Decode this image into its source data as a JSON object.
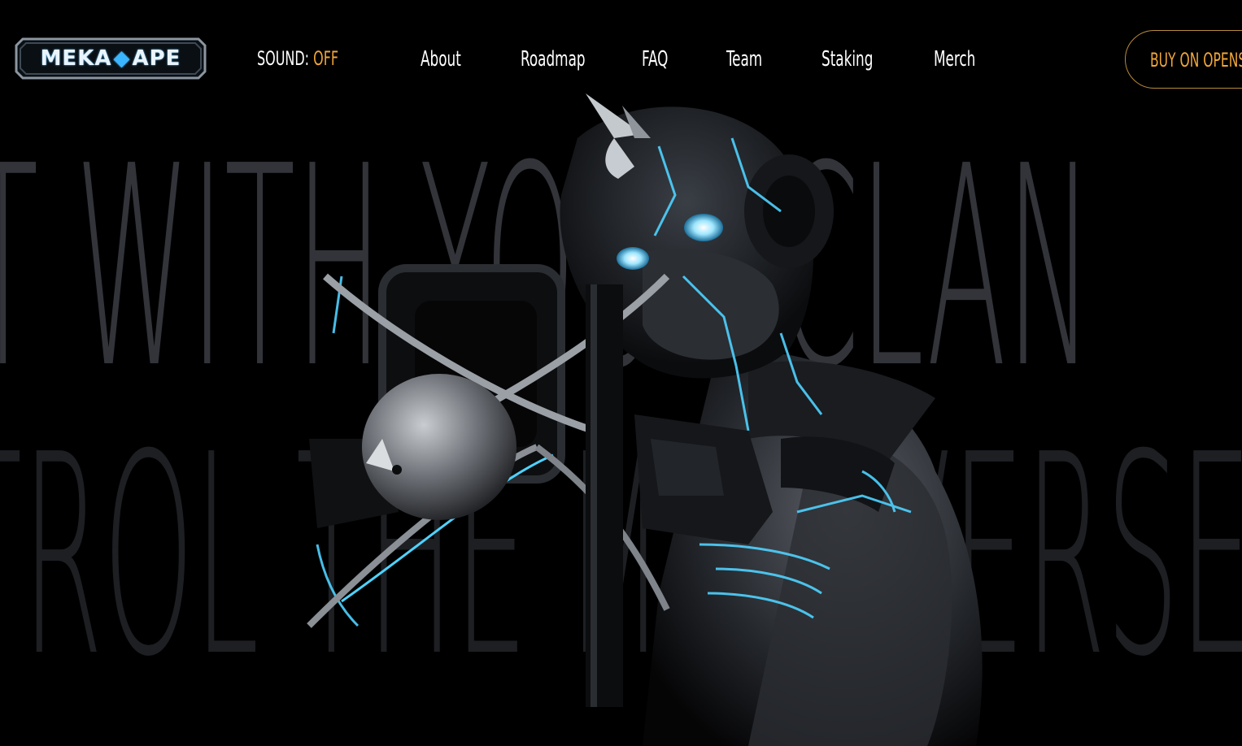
{
  "logo": {
    "left": "MEKA",
    "right": "APE",
    "icon": "diamond-gem-icon"
  },
  "sound": {
    "label": "SOUND:",
    "value": "OFF"
  },
  "nav": [
    {
      "label": "About"
    },
    {
      "label": "Roadmap"
    },
    {
      "label": "FAQ"
    },
    {
      "label": "Team"
    },
    {
      "label": "Staking"
    },
    {
      "label": "Merch"
    }
  ],
  "cta": {
    "label": "BUY ON OPENSEA"
  },
  "hero": {
    "background_line1": "T WITH YOUR CLAN",
    "background_line2": "TROL THE METAVERSE",
    "image": "meka-ape-robot-with-crossbow"
  },
  "colors": {
    "background": "#000000",
    "accent": "#f0a63a",
    "glow": "#4fd2ff",
    "bg_text": "#32343a"
  }
}
